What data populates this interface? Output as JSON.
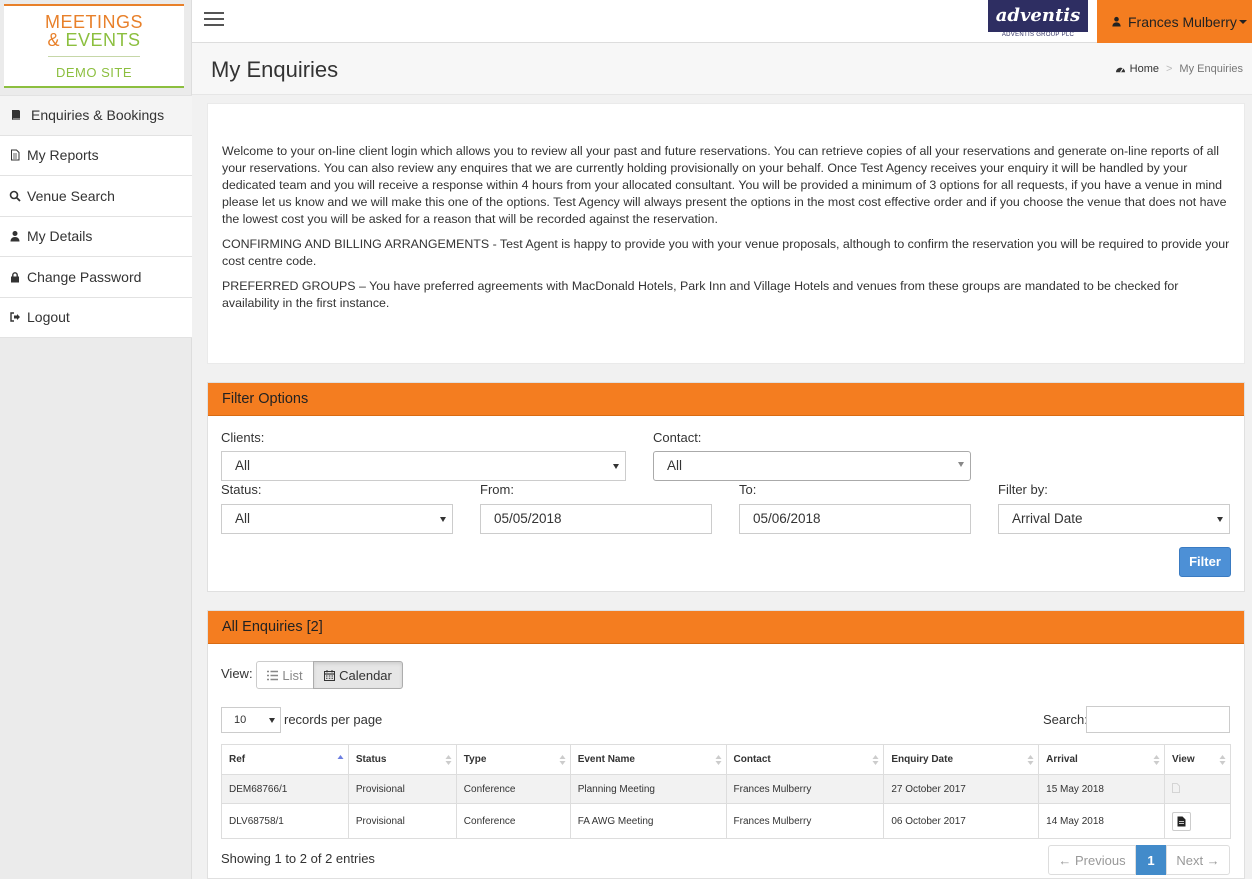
{
  "logo": {
    "line1": "MEETINGS",
    "line2_amp": "&",
    "line2": "EVENTS",
    "line3": "DEMO SITE"
  },
  "sidebar": {
    "items": [
      {
        "label": "Enquiries & Bookings",
        "icon": "book-icon"
      },
      {
        "label": "My Reports",
        "icon": "file-icon"
      },
      {
        "label": "Venue Search",
        "icon": "search-icon"
      },
      {
        "label": "My Details",
        "icon": "user-icon"
      },
      {
        "label": "Change Password",
        "icon": "lock-icon"
      },
      {
        "label": "Logout",
        "icon": "sign-out-icon"
      }
    ]
  },
  "topbar": {
    "brand": "adventis",
    "brand_sub": "ADVENTIS GROUP PLC",
    "user": "Frances Mulberry"
  },
  "header": {
    "title": "My Enquiries",
    "breadcrumb_home": "Home",
    "breadcrumb_sep": ">",
    "breadcrumb_current": "My Enquiries"
  },
  "welcome": {
    "p1": "Welcome to your on-line client login which allows you to review all your past and future reservations. You can retrieve copies of all your reservations and generate on-line reports of all your reservations. You can also review any enquires that we are currently holding provisionally on your behalf. Once Test Agency receives your enquiry it will be handled by your dedicated team and you will receive a response within 4 hours from your allocated consultant. You will be provided a minimum of 3 options for all requests, if you have a venue in mind please let us know and we will make this one of the options. Test Agency will always present the options in the most cost effective order and if you choose the venue that does not have the lowest cost you will be asked for a reason that will be recorded against the reservation.",
    "p2": "CONFIRMING AND BILLING ARRANGEMENTS - Test Agent is happy to provide you with your venue proposals, although to confirm the reservation you will be required to provide your cost centre code.",
    "p3": "PREFERRED GROUPS – You have preferred agreements with MacDonald Hotels, Park Inn and Village Hotels and venues from these groups are mandated to be checked for availability in the first instance."
  },
  "filter": {
    "title": "Filter Options",
    "clients_label": "Clients:",
    "clients_value": "All",
    "contact_label": "Contact:",
    "contact_value": "All",
    "status_label": "Status:",
    "status_value": "All",
    "from_label": "From:",
    "from_value": "05/05/2018",
    "to_label": "To:",
    "to_value": "05/06/2018",
    "filterby_label": "Filter by:",
    "filterby_value": "Arrival Date",
    "button": "Filter"
  },
  "enquiries": {
    "title": "All Enquiries [2]",
    "view_label": "View:",
    "list_label": "List",
    "calendar_label": "Calendar",
    "page_length": "10",
    "records_label": "records per page",
    "search_label": "Search:",
    "columns": [
      "Ref",
      "Status",
      "Type",
      "Event Name",
      "Contact",
      "Enquiry Date",
      "Arrival",
      "View"
    ],
    "rows": [
      [
        "DEM68766/1",
        "Provisional",
        "Conference",
        "Planning Meeting",
        "Frances Mulberry",
        "27 October 2017",
        "15 May 2018"
      ],
      [
        "DLV68758/1",
        "Provisional",
        "Conference",
        "FA AWG Meeting",
        "Frances Mulberry",
        "06 October 2017",
        "14 May 2018"
      ]
    ],
    "showing": "Showing 1 to 2 of 2 entries",
    "prev": "← Previous",
    "page": "1",
    "next": "Next →"
  },
  "colors": {
    "accent": "#f47d20",
    "primary_button": "#4d90d6",
    "brand_navy": "#2e2e62",
    "logo_green": "#8cbf3f"
  }
}
